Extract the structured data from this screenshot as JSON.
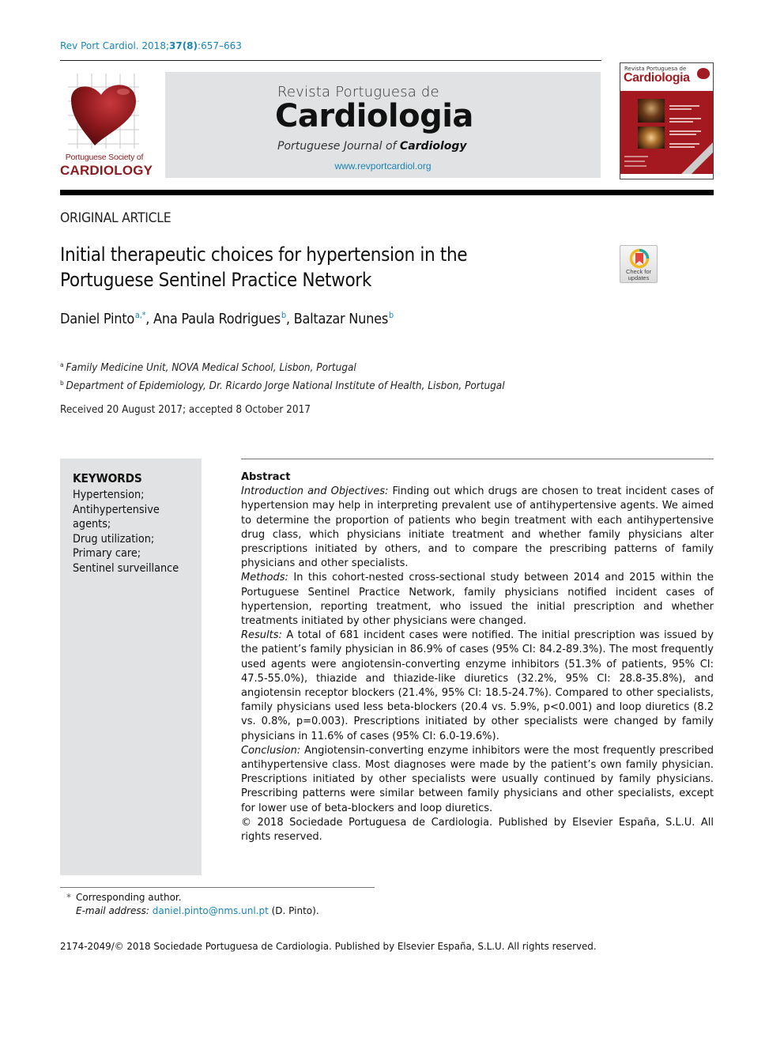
{
  "citation": {
    "journal": "Rev Port Cardiol. 2018;",
    "volume_issue": "37(8)",
    "pages": ":657–663"
  },
  "society_logo": {
    "name_line": "Portuguese Society of",
    "name_big": "CARDIOLOGY",
    "icon": "heart-icon",
    "color": "#8c1c20"
  },
  "banner": {
    "line1": "Revista Portuguesa de",
    "line2": "Cardiologia",
    "line3_prefix": "Portuguese Journal of ",
    "line3_bold": "Cardiology",
    "url": "www.revportcardiol.org",
    "bg_color": "#e1e2e3"
  },
  "cover_thumbnail": {
    "title_small": "Revista Portuguesa de",
    "title_big": "Cardiologia",
    "color": "#a3191f"
  },
  "article_type": "ORIGINAL ARTICLE",
  "title": "Initial therapeutic choices for hypertension in the Portuguese Sentinel Practice Network",
  "check_updates": {
    "label_line1": "Check for",
    "label_line2": "updates",
    "icon": "bookmark-ring-icon"
  },
  "authors": [
    {
      "name": "Daniel Pinto",
      "sup": "a,*"
    },
    {
      "name": "Ana Paula Rodrigues",
      "sup": "b"
    },
    {
      "name": "Baltazar Nunes",
      "sup": "b"
    }
  ],
  "affiliations": [
    {
      "key": "a",
      "text": "Family Medicine Unit, NOVA Medical School, Lisbon, Portugal"
    },
    {
      "key": "b",
      "text": "Department of Epidemiology, Dr. Ricardo Jorge National Institute of Health, Lisbon, Portugal"
    }
  ],
  "received": "Received 20 August 2017; accepted 8 October 2017",
  "keywords": {
    "title": "KEYWORDS",
    "items": [
      "Hypertension;",
      "Antihypertensive agents;",
      "Drug utilization;",
      "Primary care;",
      "Sentinel surveillance"
    ]
  },
  "abstract": {
    "heading": "Abstract",
    "sections": [
      {
        "label": "Introduction and Objectives:",
        "text": " Finding out which drugs are chosen to treat incident cases of hypertension may help in interpreting prevalent use of antihypertensive agents. We aimed to determine the proportion of patients who begin treatment with each antihypertensive drug class, which physicians initiate treatment and whether family physicians alter prescriptions initiated by others, and to compare the prescribing patterns of family physicians and other specialists."
      },
      {
        "label": "Methods:",
        "text": " In this cohort-nested cross-sectional study between 2014 and 2015 within the Portuguese Sentinel Practice Network, family physicians notified incident cases of hypertension, reporting treatment, who issued the initial prescription and whether treatments initiated by other physicians were changed."
      },
      {
        "label": "Results:",
        "text": " A total of 681 incident cases were notified. The initial prescription was issued by the patient’s family physician in 86.9% of cases (95% CI: 84.2-89.3%). The most frequently used agents were angiotensin-converting enzyme inhibitors (51.3% of patients, 95% CI: 47.5-55.0%), thiazide and thiazide-like diuretics (32.2%, 95% CI: 28.8-35.8%), and angiotensin receptor blockers (21.4%, 95% CI: 18.5-24.7%). Compared to other specialists, family physicians used less beta-blockers (20.4 vs. 5.9%, p<0.001) and loop diuretics (8.2 vs. 0.8%, p=0.003). Prescriptions initiated by other specialists were changed by family physicians in 11.6% of cases (95% CI: 6.0-19.6%)."
      },
      {
        "label": "Conclusion:",
        "text": " Angiotensin-converting enzyme inhibitors were the most frequently prescribed antihypertensive class. Most diagnoses were made by the patient’s own family physician. Prescriptions initiated by other specialists were usually continued by family physicians. Prescribing patterns were similar between family physicians and other specialists, except for lower use of beta-blockers and loop diuretics."
      }
    ],
    "copyright": "© 2018 Sociedade Portuguesa de Cardiologia. Published by Elsevier España, S.L.U. All rights reserved."
  },
  "footnote": {
    "star": "*",
    "corresponding": "Corresponding author.",
    "email_label": "E-mail address:",
    "email": "daniel.pinto@nms.unl.pt",
    "email_suffix": " (D. Pinto)."
  },
  "issn_line": "2174-2049/© 2018 Sociedade Portuguesa de Cardiologia. Published by Elsevier España, S.L.U. All rights reserved.",
  "colors": {
    "link": "#1a84b8",
    "keyword_box": "#e1e2e3"
  }
}
